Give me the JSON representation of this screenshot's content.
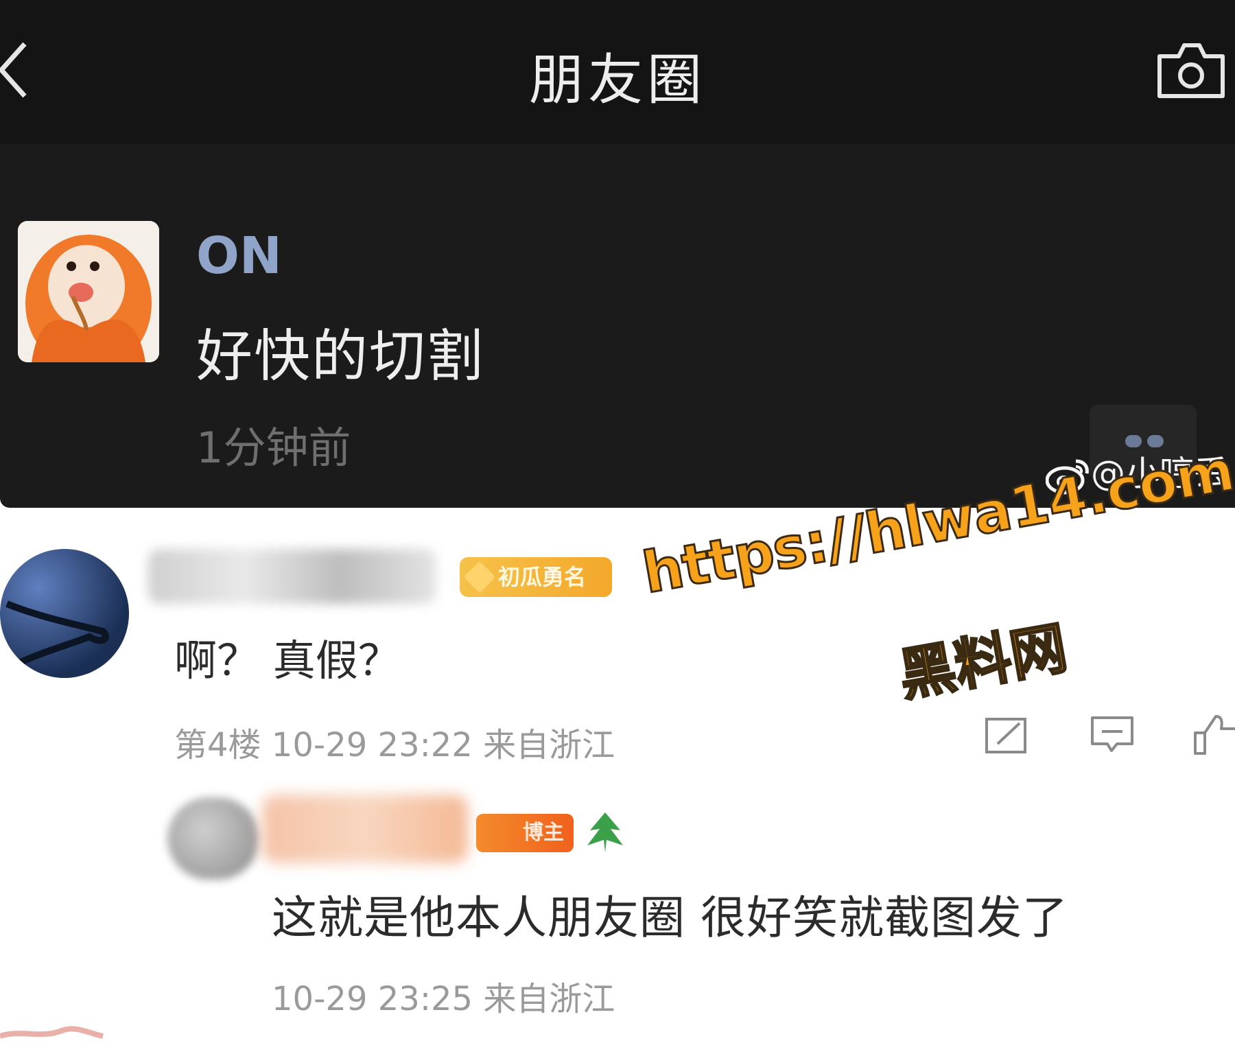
{
  "topbar": {
    "title": "朋友圈"
  },
  "moment": {
    "author": "ON",
    "text": "好快的切割",
    "time": "1分钟前"
  },
  "weibo_watermark": "@小哼丢",
  "comments": [
    {
      "text": "啊？ 真假？",
      "badge": "初瓜勇名",
      "meta": "第4楼  10-29  23:22  来自浙江"
    },
    {
      "text": "这就是他本人朋友圈 很好笑就截图发了",
      "badge": "博主",
      "meta": "10-29  23:25  来自浙江"
    }
  ],
  "site_watermark": {
    "url": "https://hlwa14.com",
    "name": "黑料网"
  },
  "icons": [
    "back-icon",
    "camera-icon",
    "more-icon",
    "weibo-logo-icon",
    "share-icon",
    "comment-icon",
    "like-icon",
    "tree-icon"
  ]
}
